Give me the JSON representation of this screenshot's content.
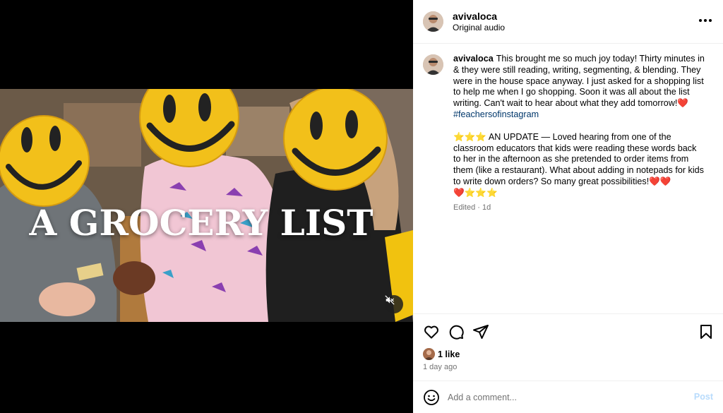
{
  "media": {
    "overlay_title": "A GROCERY LIST"
  },
  "post_header": {
    "username": "avivaloca",
    "audio": "Original audio"
  },
  "caption": {
    "username": "avivaloca",
    "paragraph1": "This brought me so much joy today! Thirty minutes in & they were still reading, writing, segmenting, & blending. They were in the house space anyway. I just asked for a shopping list to help me when I go shopping. Soon it was all about the list writing. Can't wait to hear about what they add tomorrow!",
    "paragraph1_emoji": "❤️",
    "hashtag": "#feachersofinstagram",
    "paragraph2_lead_emoji": "⭐⭐⭐",
    "paragraph2": "AN UPDATE — Loved hearing from one of the classroom educators that kids were reading these words back to her in the afternoon as she pretended to order items from them (like a restaurant). What about adding in notepads for kids to write down orders? So many great possibilities!",
    "paragraph2_end_hearts": "❤️❤️",
    "paragraph2_line_hearts": "❤️",
    "paragraph2_line_stars": "⭐⭐⭐",
    "meta": "Edited · 1d"
  },
  "engagement": {
    "likes": "1 like",
    "time_ago": "1 day ago"
  },
  "composer": {
    "placeholder": "Add a comment...",
    "post_label": "Post"
  },
  "icons": {
    "more": "more-options-icon",
    "like": "heart-icon",
    "comment": "comment-icon",
    "share": "share-icon",
    "save": "bookmark-icon",
    "mute": "muted-speaker-icon",
    "emoji": "emoji-icon"
  },
  "colors": {
    "link": "#00376b",
    "meta": "#737373",
    "post_disabled": "#b8dbfc",
    "heart": "#ed1c24"
  }
}
